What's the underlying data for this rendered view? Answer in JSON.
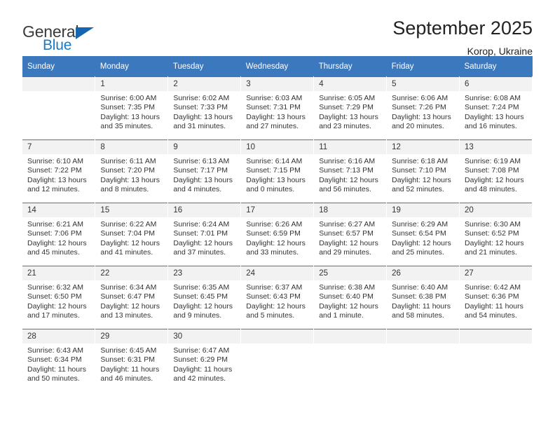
{
  "brand": {
    "name_top": "General",
    "name_bottom": "Blue",
    "triangle_color": "#1565b0",
    "blue_text_color": "#1a7ac4"
  },
  "header": {
    "title": "September 2025",
    "subtitle": "Korop, Ukraine"
  },
  "theme": {
    "header_blue": "#3c78bd",
    "daynum_background": "#f2f2f2",
    "text_color": "#333333"
  },
  "calendar": {
    "weekday_headers": [
      "Sunday",
      "Monday",
      "Tuesday",
      "Wednesday",
      "Thursday",
      "Friday",
      "Saturday"
    ],
    "labels": {
      "sunrise_prefix": "Sunrise:",
      "sunset_prefix": "Sunset:",
      "daylight_prefix": "Daylight:"
    },
    "weeks": [
      [
        {
          "day": "",
          "sunrise": "",
          "sunset": "",
          "daylight": ""
        },
        {
          "day": "1",
          "sunrise": "Sunrise: 6:00 AM",
          "sunset": "Sunset: 7:35 PM",
          "daylight": "Daylight: 13 hours and 35 minutes."
        },
        {
          "day": "2",
          "sunrise": "Sunrise: 6:02 AM",
          "sunset": "Sunset: 7:33 PM",
          "daylight": "Daylight: 13 hours and 31 minutes."
        },
        {
          "day": "3",
          "sunrise": "Sunrise: 6:03 AM",
          "sunset": "Sunset: 7:31 PM",
          "daylight": "Daylight: 13 hours and 27 minutes."
        },
        {
          "day": "4",
          "sunrise": "Sunrise: 6:05 AM",
          "sunset": "Sunset: 7:29 PM",
          "daylight": "Daylight: 13 hours and 23 minutes."
        },
        {
          "day": "5",
          "sunrise": "Sunrise: 6:06 AM",
          "sunset": "Sunset: 7:26 PM",
          "daylight": "Daylight: 13 hours and 20 minutes."
        },
        {
          "day": "6",
          "sunrise": "Sunrise: 6:08 AM",
          "sunset": "Sunset: 7:24 PM",
          "daylight": "Daylight: 13 hours and 16 minutes."
        }
      ],
      [
        {
          "day": "7",
          "sunrise": "Sunrise: 6:10 AM",
          "sunset": "Sunset: 7:22 PM",
          "daylight": "Daylight: 13 hours and 12 minutes."
        },
        {
          "day": "8",
          "sunrise": "Sunrise: 6:11 AM",
          "sunset": "Sunset: 7:20 PM",
          "daylight": "Daylight: 13 hours and 8 minutes."
        },
        {
          "day": "9",
          "sunrise": "Sunrise: 6:13 AM",
          "sunset": "Sunset: 7:17 PM",
          "daylight": "Daylight: 13 hours and 4 minutes."
        },
        {
          "day": "10",
          "sunrise": "Sunrise: 6:14 AM",
          "sunset": "Sunset: 7:15 PM",
          "daylight": "Daylight: 13 hours and 0 minutes."
        },
        {
          "day": "11",
          "sunrise": "Sunrise: 6:16 AM",
          "sunset": "Sunset: 7:13 PM",
          "daylight": "Daylight: 12 hours and 56 minutes."
        },
        {
          "day": "12",
          "sunrise": "Sunrise: 6:18 AM",
          "sunset": "Sunset: 7:10 PM",
          "daylight": "Daylight: 12 hours and 52 minutes."
        },
        {
          "day": "13",
          "sunrise": "Sunrise: 6:19 AM",
          "sunset": "Sunset: 7:08 PM",
          "daylight": "Daylight: 12 hours and 48 minutes."
        }
      ],
      [
        {
          "day": "14",
          "sunrise": "Sunrise: 6:21 AM",
          "sunset": "Sunset: 7:06 PM",
          "daylight": "Daylight: 12 hours and 45 minutes."
        },
        {
          "day": "15",
          "sunrise": "Sunrise: 6:22 AM",
          "sunset": "Sunset: 7:04 PM",
          "daylight": "Daylight: 12 hours and 41 minutes."
        },
        {
          "day": "16",
          "sunrise": "Sunrise: 6:24 AM",
          "sunset": "Sunset: 7:01 PM",
          "daylight": "Daylight: 12 hours and 37 minutes."
        },
        {
          "day": "17",
          "sunrise": "Sunrise: 6:26 AM",
          "sunset": "Sunset: 6:59 PM",
          "daylight": "Daylight: 12 hours and 33 minutes."
        },
        {
          "day": "18",
          "sunrise": "Sunrise: 6:27 AM",
          "sunset": "Sunset: 6:57 PM",
          "daylight": "Daylight: 12 hours and 29 minutes."
        },
        {
          "day": "19",
          "sunrise": "Sunrise: 6:29 AM",
          "sunset": "Sunset: 6:54 PM",
          "daylight": "Daylight: 12 hours and 25 minutes."
        },
        {
          "day": "20",
          "sunrise": "Sunrise: 6:30 AM",
          "sunset": "Sunset: 6:52 PM",
          "daylight": "Daylight: 12 hours and 21 minutes."
        }
      ],
      [
        {
          "day": "21",
          "sunrise": "Sunrise: 6:32 AM",
          "sunset": "Sunset: 6:50 PM",
          "daylight": "Daylight: 12 hours and 17 minutes."
        },
        {
          "day": "22",
          "sunrise": "Sunrise: 6:34 AM",
          "sunset": "Sunset: 6:47 PM",
          "daylight": "Daylight: 12 hours and 13 minutes."
        },
        {
          "day": "23",
          "sunrise": "Sunrise: 6:35 AM",
          "sunset": "Sunset: 6:45 PM",
          "daylight": "Daylight: 12 hours and 9 minutes."
        },
        {
          "day": "24",
          "sunrise": "Sunrise: 6:37 AM",
          "sunset": "Sunset: 6:43 PM",
          "daylight": "Daylight: 12 hours and 5 minutes."
        },
        {
          "day": "25",
          "sunrise": "Sunrise: 6:38 AM",
          "sunset": "Sunset: 6:40 PM",
          "daylight": "Daylight: 12 hours and 1 minute."
        },
        {
          "day": "26",
          "sunrise": "Sunrise: 6:40 AM",
          "sunset": "Sunset: 6:38 PM",
          "daylight": "Daylight: 11 hours and 58 minutes."
        },
        {
          "day": "27",
          "sunrise": "Sunrise: 6:42 AM",
          "sunset": "Sunset: 6:36 PM",
          "daylight": "Daylight: 11 hours and 54 minutes."
        }
      ],
      [
        {
          "day": "28",
          "sunrise": "Sunrise: 6:43 AM",
          "sunset": "Sunset: 6:34 PM",
          "daylight": "Daylight: 11 hours and 50 minutes."
        },
        {
          "day": "29",
          "sunrise": "Sunrise: 6:45 AM",
          "sunset": "Sunset: 6:31 PM",
          "daylight": "Daylight: 11 hours and 46 minutes."
        },
        {
          "day": "30",
          "sunrise": "Sunrise: 6:47 AM",
          "sunset": "Sunset: 6:29 PM",
          "daylight": "Daylight: 11 hours and 42 minutes."
        },
        {
          "day": "",
          "sunrise": "",
          "sunset": "",
          "daylight": ""
        },
        {
          "day": "",
          "sunrise": "",
          "sunset": "",
          "daylight": ""
        },
        {
          "day": "",
          "sunrise": "",
          "sunset": "",
          "daylight": ""
        },
        {
          "day": "",
          "sunrise": "",
          "sunset": "",
          "daylight": ""
        }
      ]
    ]
  }
}
